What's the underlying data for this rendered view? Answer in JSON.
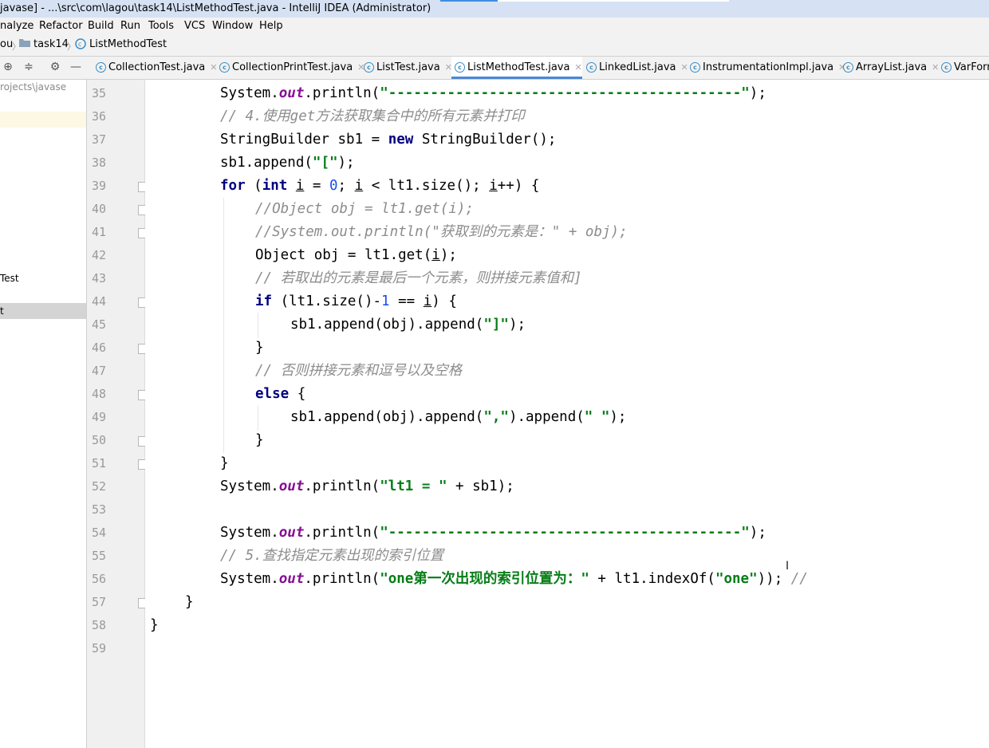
{
  "window": {
    "title": "javase] - ...\\src\\com\\lagou\\task14\\ListMethodTest.java - IntelliJ IDEA (Administrator)"
  },
  "menu": [
    "nalyze",
    "Refactor",
    "Build",
    "Run",
    "Tools",
    "VCS",
    "Window",
    "Help"
  ],
  "breadcrumb": [
    "ou",
    "task14",
    "ListMethodTest"
  ],
  "tabs": [
    {
      "label": "CollectionTest.java",
      "active": false
    },
    {
      "label": "CollectionPrintTest.java",
      "active": false
    },
    {
      "label": "ListTest.java",
      "active": false
    },
    {
      "label": "ListMethodTest.java",
      "active": true
    },
    {
      "label": "LinkedList.java",
      "active": false
    },
    {
      "label": "InstrumentationImpl.java",
      "active": false
    },
    {
      "label": "ArrayList.java",
      "active": false
    },
    {
      "label": "VarForm",
      "active": false
    }
  ],
  "project": {
    "path": "rojects\\javase",
    "item_test": "Test",
    "item_t": "t"
  },
  "editor": {
    "line_numbers": [
      "35",
      "36",
      "37",
      "38",
      "39",
      "40",
      "41",
      "42",
      "43",
      "44",
      "45",
      "46",
      "47",
      "48",
      "49",
      "50",
      "51",
      "52",
      "53",
      "54",
      "55",
      "56",
      "57",
      "58",
      "59"
    ],
    "code": {
      "l35_pre": "System.",
      "l35_out": "out",
      "l35_mid": ".println(",
      "l35_str": "\"------------------------------------------\"",
      "l35_end": ");",
      "l36": "// 4.使用get方法获取集合中的所有元素并打印",
      "l37_pre": "StringBuilder sb1 = ",
      "l37_kw": "new",
      "l37_end": " StringBuilder();",
      "l38_pre": "sb1.append(",
      "l38_str": "\"[\"",
      "l38_end": ");",
      "l39_kw": "for",
      "l39_a": " (",
      "l39_int": "int",
      "l39_b": " ",
      "l39_i1": "i",
      "l39_c": " = ",
      "l39_zero": "0",
      "l39_d": "; ",
      "l39_i2": "i",
      "l39_e": " < lt1.size(); ",
      "l39_i3": "i",
      "l39_f": "++) {",
      "l40": "//Object obj = lt1.get(i);",
      "l41": "//System.out.println(\"获取到的元素是：\" + obj);",
      "l42_pre": "Object obj = lt1.get(",
      "l42_i": "i",
      "l42_end": ");",
      "l43": "// 若取出的元素是最后一个元素，则拼接元素值和]",
      "l44_kw": "if",
      "l44_a": " (lt1.size()-",
      "l44_one": "1",
      "l44_b": " == ",
      "l44_i": "i",
      "l44_c": ") {",
      "l45_pre": "sb1.append(obj).append(",
      "l45_str": "\"]\"",
      "l45_end": ");",
      "l46": "}",
      "l47": "// 否则拼接元素和逗号以及空格",
      "l48_kw": "else",
      "l48_end": " {",
      "l49_pre": "sb1.append(obj).append(",
      "l49_str1": "\",\"",
      "l49_mid": ").append(",
      "l49_str2": "\" \"",
      "l49_end": ");",
      "l50": "}",
      "l51": "}",
      "l52_pre": "System.",
      "l52_out": "out",
      "l52_mid": ".println(",
      "l52_str": "\"lt1 = \"",
      "l52_end": " + sb1);",
      "l54_pre": "System.",
      "l54_out": "out",
      "l54_mid": ".println(",
      "l54_str": "\"------------------------------------------\"",
      "l54_end": ");",
      "l55": "// 5.查找指定元素出现的索引位置",
      "l56_pre": "System.",
      "l56_out": "out",
      "l56_mid": ".println(",
      "l56_str1": "\"one第一次出现的索引位置为：\"",
      "l56_a": " + lt1.indexOf(",
      "l56_str2": "\"one\"",
      "l56_b": ")); ",
      "l56_cmt": "//",
      "l57": "}",
      "l58": "}"
    }
  }
}
